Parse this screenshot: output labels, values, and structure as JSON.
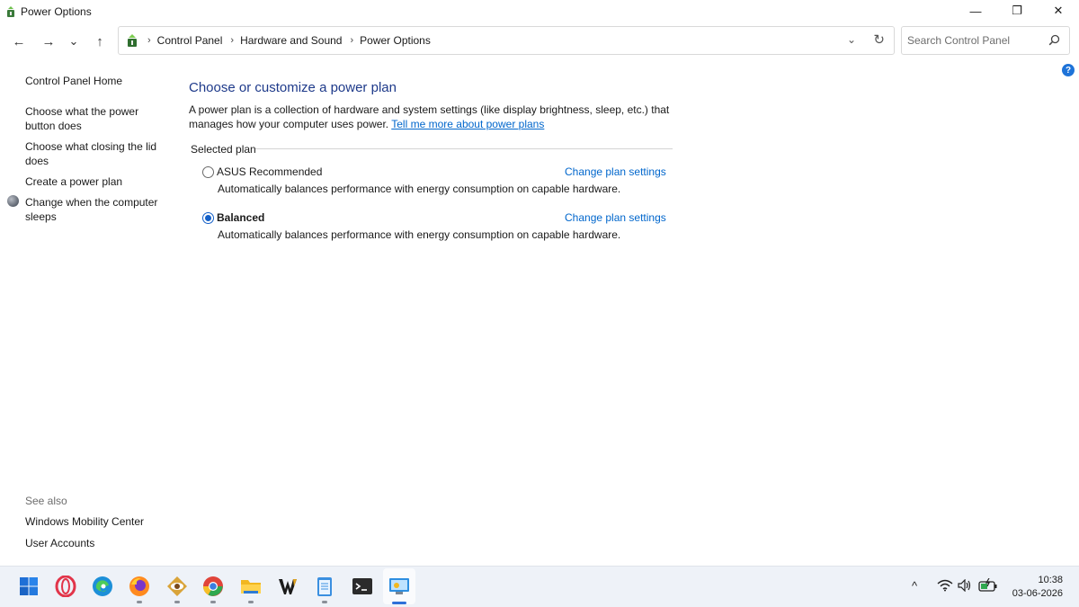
{
  "window": {
    "title": "Power Options",
    "controls": {
      "minimize": "—",
      "restore": "❐",
      "close": "✕"
    }
  },
  "nav": {
    "back": "←",
    "forward": "→",
    "recent": "⌄",
    "up": "↑"
  },
  "address": {
    "breadcrumbs": [
      "Control Panel",
      "Hardware and Sound",
      "Power Options"
    ],
    "separator": "›",
    "dropdown": "⌄",
    "refresh": "↻"
  },
  "search": {
    "placeholder": "Search Control Panel"
  },
  "help": {
    "label": "?"
  },
  "left_pane": {
    "home": "Control Panel Home",
    "links": [
      "Choose what the power button does",
      "Choose what closing the lid does",
      "Create a power plan",
      "Change when the computer sleeps"
    ],
    "see_also_label": "See also",
    "see_also": [
      "Windows Mobility Center",
      "User Accounts"
    ]
  },
  "main": {
    "title": "Choose or customize a power plan",
    "description": "A power plan is a collection of hardware and system settings (like display brightness, sleep, etc.) that manages how your computer uses power.",
    "more_link": "Tell me more about power plans",
    "section_label": "Selected plan",
    "plans": [
      {
        "name": "ASUS Recommended",
        "selected": false,
        "description": "Automatically balances performance with energy consumption on capable hardware.",
        "link": "Change plan settings"
      },
      {
        "name": "Balanced",
        "selected": true,
        "description": "Automatically balances performance with energy consumption on capable hardware.",
        "link": "Change plan settings"
      }
    ]
  },
  "taskbar": {
    "apps": [
      "start-icon",
      "opera-icon",
      "edge-icon",
      "firefox-icon",
      "eye-app-icon",
      "chrome-icon",
      "file-explorer-icon",
      "w-app-icon",
      "notepad-icon",
      "terminal-icon",
      "control-panel-icon"
    ],
    "tray": {
      "chevron": "^",
      "wifi": "wifi-icon",
      "volume": "volume-icon",
      "battery": "battery-icon"
    },
    "clock": {
      "time": "10:38",
      "date": "03-06-2026"
    }
  },
  "colors": {
    "title_blue": "#1e3a8a",
    "link_blue": "#0066cc",
    "radio_blue": "#1460c8",
    "taskbar_bg": "#eef2f8"
  }
}
